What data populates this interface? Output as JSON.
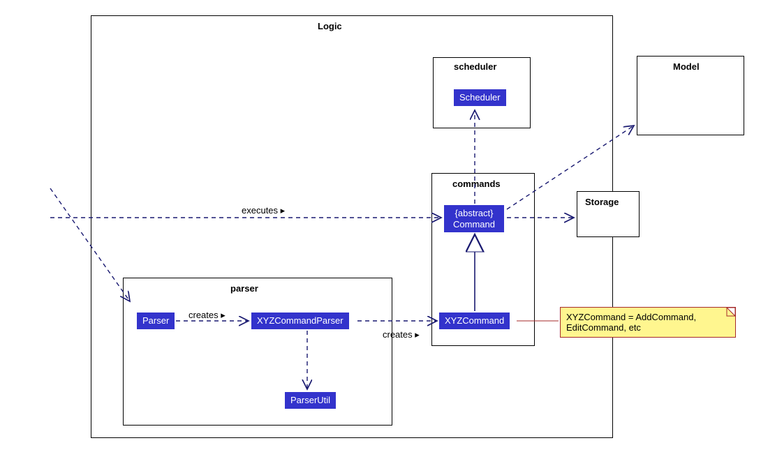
{
  "packages": {
    "logic": {
      "title": "Logic"
    },
    "scheduler": {
      "title": "scheduler"
    },
    "commands": {
      "title": "commands"
    },
    "parser": {
      "title": "parser"
    },
    "model": {
      "title": "Model"
    },
    "storage": {
      "title": "Storage"
    }
  },
  "classes": {
    "scheduler": "Scheduler",
    "abstract_command_stereotype": "{abstract}",
    "abstract_command_name": "Command",
    "xyz_command": "XYZCommand",
    "parser": "Parser",
    "xyz_command_parser": "XYZCommandParser",
    "parser_util": "ParserUtil"
  },
  "edges": {
    "executes": "executes ▸",
    "creates1": "creates ▸",
    "creates2": "creates ▸"
  },
  "note": {
    "line1": "XYZCommand = AddCommand,",
    "line2": "EditCommand, etc"
  },
  "colors": {
    "class_fill": "#3333cc",
    "line": "#191970",
    "note_fill": "#fff68f",
    "note_border": "#a52a2a"
  }
}
